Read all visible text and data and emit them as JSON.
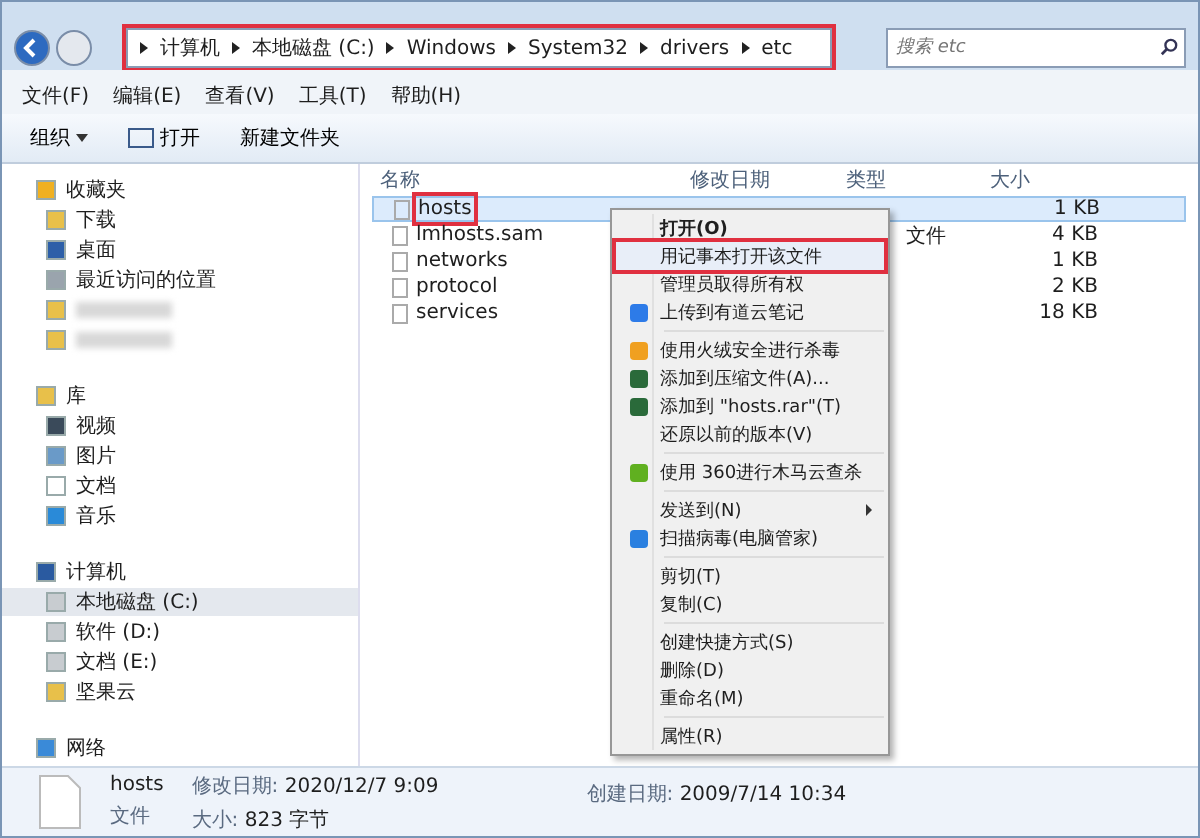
{
  "address_bar": {
    "breadcrumb": [
      "计算机",
      "本地磁盘 (C:)",
      "Windows",
      "System32",
      "drivers",
      "etc"
    ],
    "highlighted": true
  },
  "search": {
    "placeholder": "搜索 etc"
  },
  "menu_bar": [
    "文件(F)",
    "编辑(E)",
    "查看(V)",
    "工具(T)",
    "帮助(H)"
  ],
  "toolbar": [
    {
      "label": "组织",
      "kind": "dropdown"
    },
    {
      "label": "打开",
      "kind": "icon"
    },
    {
      "label": "新建文件夹",
      "kind": "plain"
    }
  ],
  "sidebar": {
    "groups": [
      {
        "label": "收藏夹",
        "items": [
          {
            "label": "下载",
            "selected": false
          },
          {
            "label": "桌面",
            "selected": false
          },
          {
            "label": "最近访问的位置",
            "selected": false
          },
          {
            "kind": "blurred",
            "selected": false
          },
          {
            "kind": "blurred",
            "selected": false
          }
        ]
      },
      {
        "label": "库",
        "items": [
          {
            "label": "视频",
            "selected": false
          },
          {
            "label": "图片",
            "selected": false
          },
          {
            "label": "文档",
            "selected": false
          },
          {
            "label": "音乐",
            "selected": false
          }
        ]
      },
      {
        "label": "计算机",
        "items": [
          {
            "label": "本地磁盘 (C:)",
            "selected": true
          },
          {
            "label": "软件 (D:)",
            "selected": false
          },
          {
            "label": "文档 (E:)",
            "selected": false
          },
          {
            "label": "坚果云",
            "selected": false
          }
        ]
      },
      {
        "label": "网络"
      }
    ]
  },
  "table": {
    "columns": [
      "名称",
      "修改日期",
      "类型",
      "大小"
    ],
    "rows": [
      {
        "name": "hosts",
        "type": "",
        "size": "1 KB",
        "selected": true,
        "highlighted": true
      },
      {
        "name": "lmhosts.sam",
        "type": "文件",
        "size": "4 KB",
        "selected": false,
        "highlighted": false
      },
      {
        "name": "networks",
        "type": "",
        "size": "1 KB",
        "selected": false,
        "highlighted": false
      },
      {
        "name": "protocol",
        "type": "",
        "size": "2 KB",
        "selected": false,
        "highlighted": false
      },
      {
        "name": "services",
        "type": "",
        "size": "18 KB",
        "selected": false,
        "highlighted": false
      }
    ]
  },
  "context_menu": [
    {
      "kind": "item",
      "label": "打开(O)",
      "bold": true,
      "highlighted": false
    },
    {
      "kind": "item",
      "label": "用记事本打开该文件",
      "highlighted": true
    },
    {
      "kind": "item",
      "label": "管理员取得所有权",
      "highlighted": false
    },
    {
      "kind": "item",
      "label": "上传到有道云笔记",
      "highlighted": false
    },
    {
      "kind": "separator"
    },
    {
      "kind": "item",
      "label": "使用火绒安全进行杀毒",
      "highlighted": false
    },
    {
      "kind": "item",
      "label": "添加到压缩文件(A)...",
      "highlighted": false
    },
    {
      "kind": "item",
      "label": "添加到 \"hosts.rar\"(T)",
      "highlighted": false
    },
    {
      "kind": "item",
      "label": "还原以前的版本(V)",
      "highlighted": false
    },
    {
      "kind": "separator"
    },
    {
      "kind": "item",
      "label": "使用 360进行木马云查杀",
      "highlighted": false
    },
    {
      "kind": "separator"
    },
    {
      "kind": "submenu",
      "label": "发送到(N)",
      "highlighted": false
    },
    {
      "kind": "item",
      "label": "扫描病毒(电脑管家)",
      "highlighted": false
    },
    {
      "kind": "separator"
    },
    {
      "kind": "item",
      "label": "剪切(T)",
      "highlighted": false
    },
    {
      "kind": "item",
      "label": "复制(C)",
      "highlighted": false
    },
    {
      "kind": "separator"
    },
    {
      "kind": "item",
      "label": "创建快捷方式(S)",
      "highlighted": false
    },
    {
      "kind": "item",
      "label": "删除(D)",
      "highlighted": false
    },
    {
      "kind": "item",
      "label": "重命名(M)",
      "highlighted": false
    },
    {
      "kind": "separator"
    },
    {
      "kind": "item",
      "label": "属性(R)",
      "highlighted": false
    }
  ],
  "details": {
    "name": "hosts",
    "type": "文件",
    "fields": [
      {
        "label": "修改日期:",
        "value": "2020/12/7 9:09"
      },
      {
        "label": "大小:",
        "value": "823 字节"
      },
      {
        "label": "创建日期:",
        "value": "2009/7/14 10:34"
      }
    ]
  }
}
